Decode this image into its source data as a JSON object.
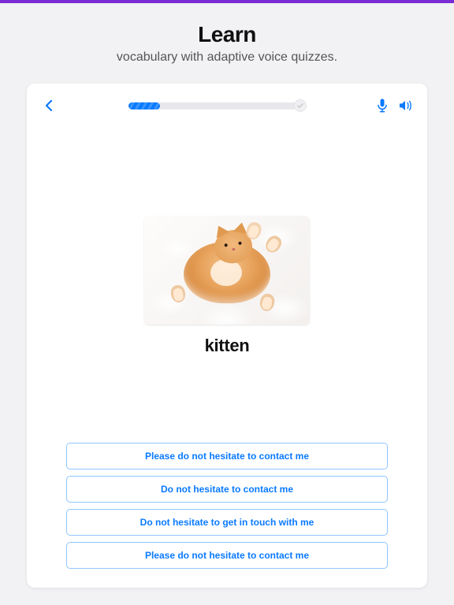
{
  "accent_color": "#7a2bd4",
  "primary_color": "#0a7aff",
  "header": {
    "title": "Learn",
    "subtitle": "vocabulary with adaptive voice quizzes."
  },
  "quiz": {
    "progress_percent": 18,
    "image_alt": "kitten",
    "word": "kitten",
    "answers": [
      "Please do not hesitate to contact me",
      "Do not hesitate to contact me",
      "Do not hesitate to get in touch with me",
      "Please do not hesitate to contact me"
    ]
  },
  "icons": {
    "back": "chevron-left-icon",
    "mic": "microphone-icon",
    "speaker": "speaker-icon",
    "check": "check-icon"
  }
}
